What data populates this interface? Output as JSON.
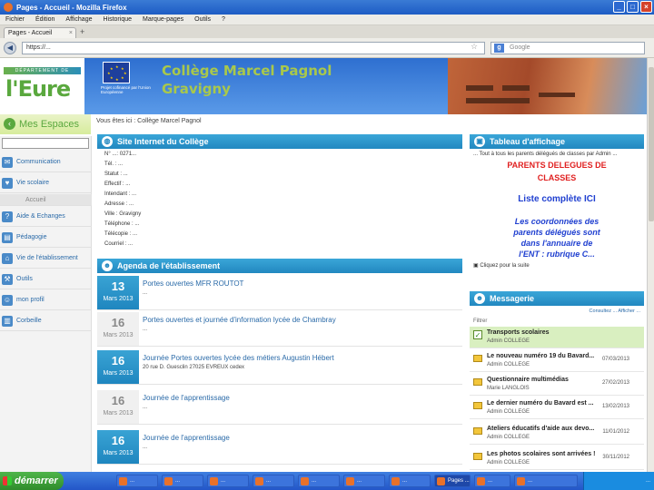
{
  "window": {
    "title": "Pages - Accueil - Mozilla Firefox"
  },
  "menu": [
    "Fichier",
    "Édition",
    "Affichage",
    "Historique",
    "Marque-pages",
    "Outils",
    "?"
  ],
  "tab": {
    "label": "Pages - Accueil"
  },
  "nav": {
    "url": "https://...",
    "search_placeholder": "Google"
  },
  "header": {
    "logo_band": "DÉPARTEMENT DE",
    "logo_text": "l'Eure",
    "eu_text": "Projet cofinancé par l'Union Européenne",
    "college_line1": "Collège Marcel Pagnol",
    "college_line2": "Gravigny"
  },
  "mes_espaces": "Mes Espaces",
  "breadcrumb": "Vous êtes ici : Collège Marcel Pagnol",
  "sidebar": {
    "items": [
      {
        "label": "Communication",
        "icon": "envelope-icon"
      },
      {
        "label": "Vie scolaire",
        "icon": "heart-icon"
      },
      {
        "label": "Accueil",
        "icon": "",
        "sub": true
      },
      {
        "label": "Aide & Echanges",
        "icon": "help-icon"
      },
      {
        "label": "Pédagogie",
        "icon": "book-icon"
      },
      {
        "label": "Vie de l'établissement",
        "icon": "building-icon"
      },
      {
        "label": "Outils",
        "icon": "wrench-icon"
      },
      {
        "label": "mon profil",
        "icon": "user-icon"
      },
      {
        "label": "Corbeille",
        "icon": "trash-icon"
      }
    ]
  },
  "site": {
    "heading": "Site Internet du Collège",
    "lines": [
      "N° ...: 0271...",
      "Tél. : ...",
      "Statut : ...",
      "Effectif : ...",
      "Intendant : ...",
      "Adresse : ...",
      "Ville : Gravigny",
      "Téléphone : ...",
      "Télécopie : ...",
      "Courriel : ..."
    ]
  },
  "agenda": {
    "heading": "Agenda de l'établissement",
    "events": [
      {
        "day": "13",
        "month": "Mars 2013",
        "title": "Portes ouvertes MFR ROUTOT",
        "sub": "...",
        "active": true
      },
      {
        "day": "16",
        "month": "Mars 2013",
        "title": "Portes ouvertes et journée d'information lycée de Chambray",
        "sub": "...",
        "active": false
      },
      {
        "day": "16",
        "month": "Mars 2013",
        "title": "Journée Portes ouvertes lycée des métiers Augustin Hébert",
        "sub": "20 rue D. Guesclin 27025 EVREUX cedex",
        "active": true
      },
      {
        "day": "16",
        "month": "Mars 2013",
        "title": "Journée de l'apprentissage",
        "sub": "...",
        "active": false
      },
      {
        "day": "16",
        "month": "Mars 2013",
        "title": "Journée de l'apprentissage",
        "sub": "...",
        "active": true
      }
    ]
  },
  "notice": {
    "heading": "Tableau d'affichage",
    "meta": "... Tout à tous les parents délégués de classes par Admin ...",
    "red_line1": "PARENTS DELEGUES DE",
    "red_line2": "CLASSES",
    "blue_line": "Liste complète ICI",
    "italic_line1": "Les coordonnées des",
    "italic_line2": "parents délégués sont",
    "italic_line3": "dans l'annuaire de",
    "italic_line4": "l'ENT : rubrique C...",
    "more": "Cliquez pour la suite"
  },
  "messagerie": {
    "heading": "Messagerie",
    "links": "Consultez ...   Afficher ...",
    "filter": "Filtrer",
    "messages": [
      {
        "subject": "Transports scolaires",
        "from": "Admin COLLEGE",
        "date": "",
        "selected": true
      },
      {
        "subject": "Le nouveau numéro 19 du Bavard...",
        "from": "Admin COLLEGE",
        "date": "07/03/2013",
        "selected": false
      },
      {
        "subject": "Questionnaire multimédias",
        "from": "Marie LANGLOIS",
        "date": "27/02/2013",
        "selected": false
      },
      {
        "subject": "Le dernier numéro du Bavard est ...",
        "from": "Admin COLLEGE",
        "date": "13/02/2013",
        "selected": false
      },
      {
        "subject": "Ateliers éducatifs d'aide aux devo...",
        "from": "Admin COLLEGE",
        "date": "11/01/2012",
        "selected": false
      },
      {
        "subject": "Les photos scolaires sont arrivées !",
        "from": "Admin COLLEGE",
        "date": "30/11/2012",
        "selected": false
      }
    ]
  },
  "taskbar": {
    "start": "démarrer",
    "items": [
      "...",
      "...",
      "...",
      "...",
      "...",
      "...",
      "...",
      "Pages ...",
      "...",
      "..."
    ],
    "clock": "..."
  }
}
